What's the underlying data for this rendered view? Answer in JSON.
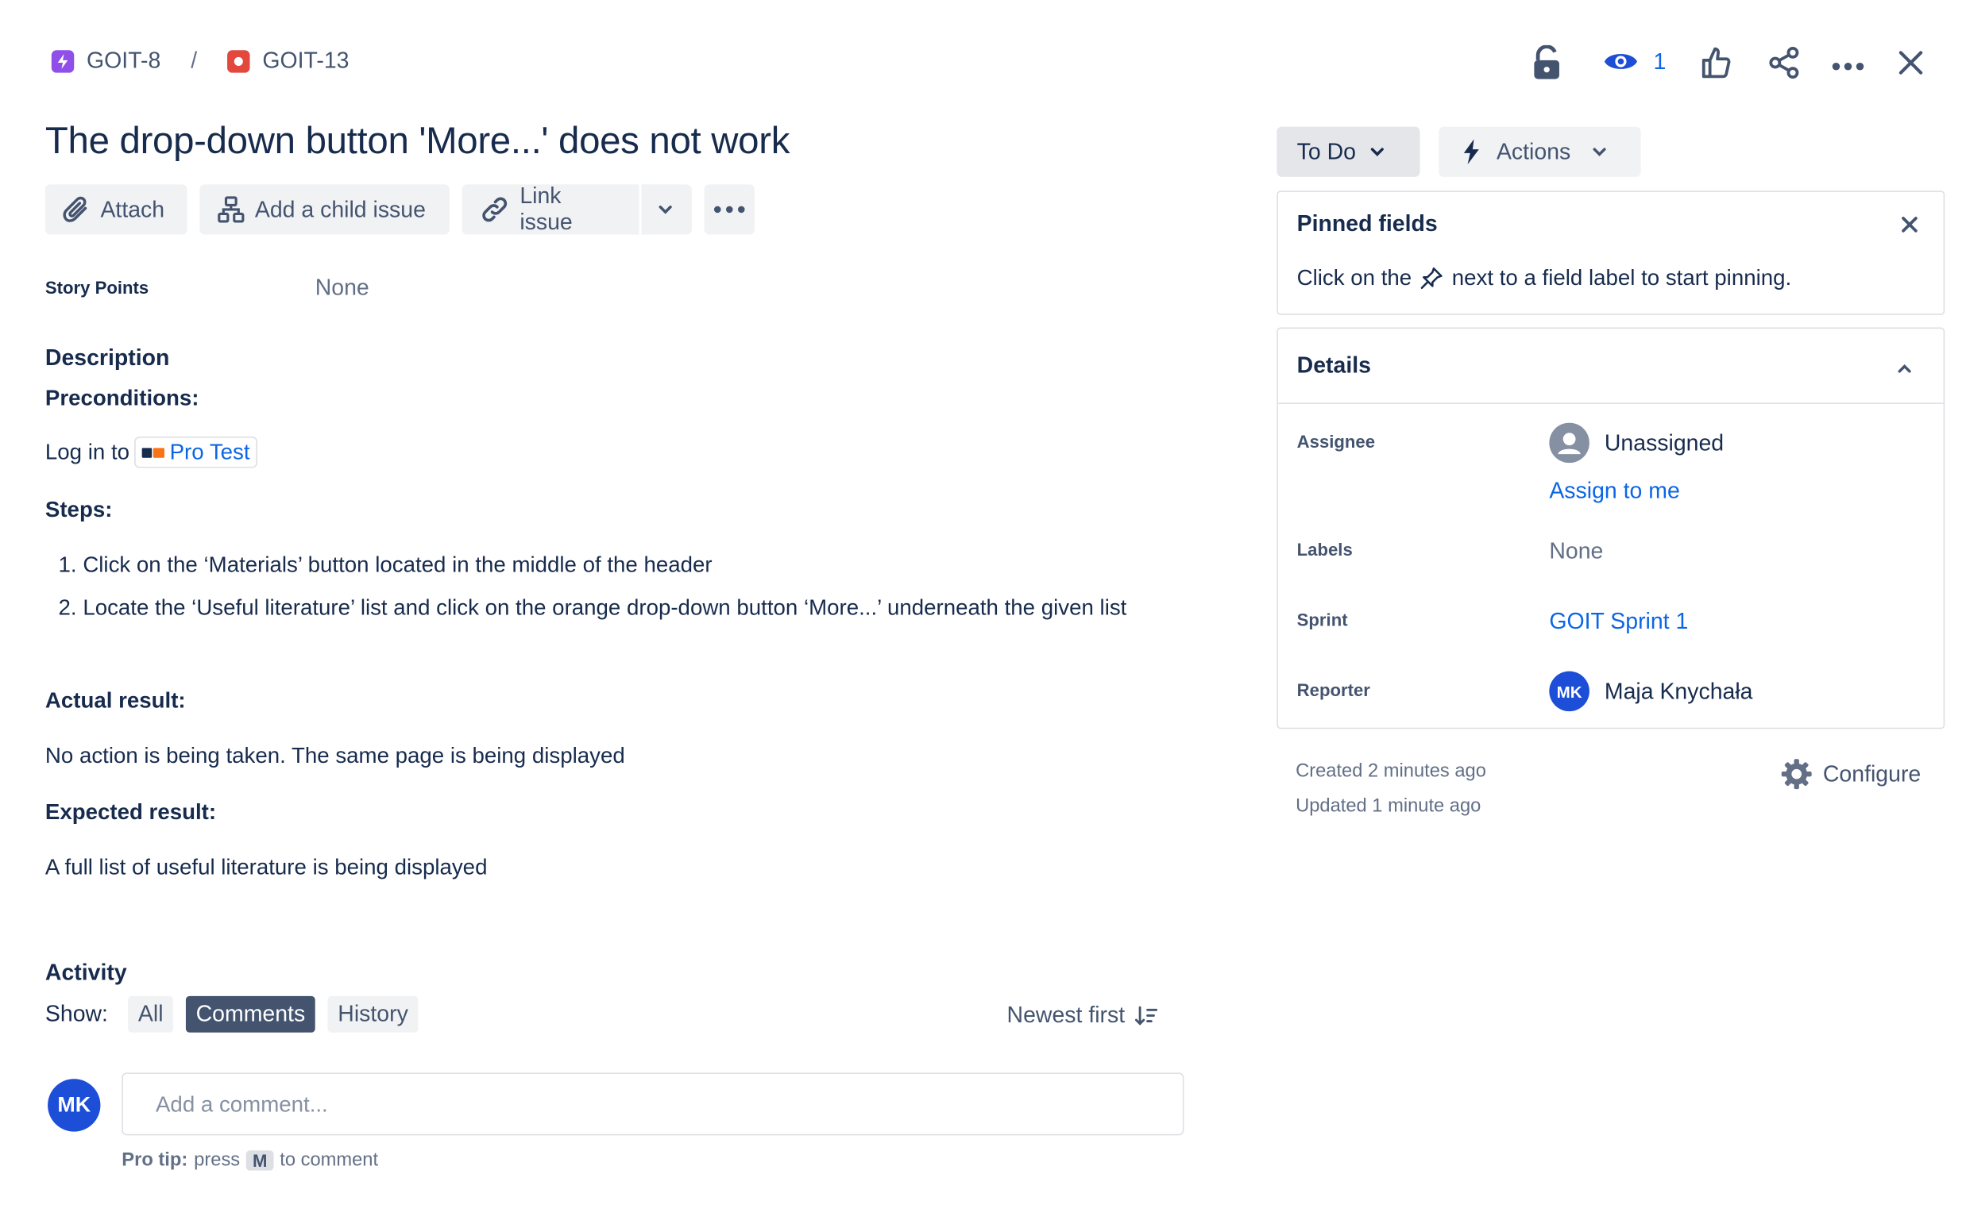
{
  "breadcrumb": {
    "parent_key": "GOIT-8",
    "separator": "/",
    "issue_key": "GOIT-13"
  },
  "header_actions": {
    "watch_count": "1"
  },
  "issue": {
    "title": "The drop-down button 'More...' does not work"
  },
  "toolbar": {
    "attach_label": "Attach",
    "add_child_label": "Add a child issue",
    "link_issue_label": "Link issue"
  },
  "fields": {
    "story_points_label": "Story Points",
    "story_points_value": "None"
  },
  "description": {
    "heading": "Description",
    "preconditions_label": "Preconditions:",
    "login_prefix": "Log in to",
    "login_link": "Pro Test",
    "steps_label": "Steps:",
    "steps": [
      "Click on the ‘Materials’ button located in the middle of the header",
      "Locate the ‘Useful literature’ list and click on the orange drop-down button ‘More...’ underneath the given list"
    ],
    "actual_label": "Actual result:",
    "actual_text": "No action is being taken. The same page is being displayed",
    "expected_label": "Expected result:",
    "expected_text": "A full list of useful literature is being displayed"
  },
  "activity": {
    "heading": "Activity",
    "show_label": "Show:",
    "filters": [
      "All",
      "Comments",
      "History"
    ],
    "active_filter": "Comments",
    "sort_label": "Newest first",
    "user_initials": "MK",
    "comment_placeholder": "Add a comment...",
    "tip_prefix": "Pro tip:",
    "tip_press": "press",
    "tip_key": "M",
    "tip_suffix": "to comment"
  },
  "status": {
    "status_label": "To Do",
    "actions_label": "Actions"
  },
  "pinned": {
    "title": "Pinned fields",
    "text_before": "Click on the",
    "text_after": "next to a field label to start pinning."
  },
  "details": {
    "title": "Details",
    "assignee_label": "Assignee",
    "assignee_value": "Unassigned",
    "assign_to_me": "Assign to me",
    "labels_label": "Labels",
    "labels_value": "None",
    "sprint_label": "Sprint",
    "sprint_value": "GOIT Sprint 1",
    "reporter_label": "Reporter",
    "reporter_initials": "MK",
    "reporter_name": "Maja Knychała"
  },
  "meta": {
    "created": "Created 2 minutes ago",
    "updated": "Updated 1 minute ago",
    "configure_label": "Configure"
  },
  "colors": {
    "epic": "#8f4fe8",
    "bug": "#e2483d",
    "link": "#0c66e4",
    "active_chip": "#44546f",
    "avatar": "#1d4ed8"
  }
}
